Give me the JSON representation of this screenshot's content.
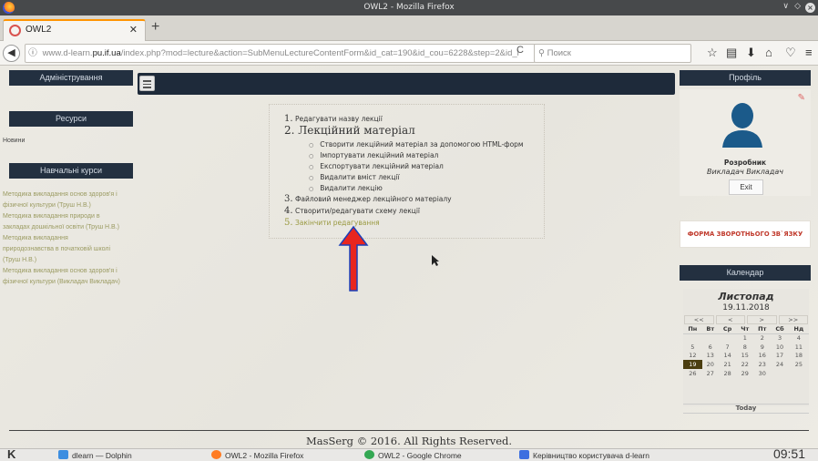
{
  "window": {
    "title": "OWL2 - Mozilla Firefox"
  },
  "tabs": [
    {
      "label": "OWL2"
    }
  ],
  "nav": {
    "url_prefix": "www.d-learn.",
    "url_domain": "pu.if.ua",
    "url_rest": "/index.php?mod=lecture&action=SubMenuLectureContentForm&id_cat=190&id_cou=6228&step=2&id_l",
    "search_placeholder": "Поиск"
  },
  "left_sidebar": {
    "admin_title": "Адміністрування",
    "resources_title": "Ресурси",
    "resources_items": [
      "Новини"
    ],
    "courses_title": "Навчальні курси",
    "courses_lines": [
      "Методика викладання основ здоров'я і",
      "фізичної культури (Труш Н.В.)",
      "Методика викладання природи в",
      "закладах дошкільної освіти (Труш Н.В.)",
      "Методика викладання",
      "природознавства в початковій школі",
      "(Труш Н.В.)",
      "Методика викладання основ здоров'я і",
      "фізичної культури (Викладач Викладач)"
    ]
  },
  "lecture_menu": {
    "items": [
      {
        "num": "1.",
        "label": "Редагувати назву лекції"
      },
      {
        "num": "2.",
        "label": "Лекційний матеріал"
      },
      {
        "num": "3.",
        "label": "Файловий менеджер лекційного матеріалу"
      },
      {
        "num": "4.",
        "label": "Створити/редагувати схему лекції"
      },
      {
        "num": "5.",
        "label": "Закінчити редагування"
      }
    ],
    "subitems": [
      "Створити лекційний матеріал за допомогою HTML-форм",
      "Імпортувати лекційний матеріал",
      "Експортувати лекційний матеріал",
      "Видалити вміст лекції",
      "Видалити лекцію"
    ]
  },
  "profile": {
    "title": "Профіль",
    "name": "Розробник",
    "role": "Викладач  Викладач",
    "exit_label": "Exit"
  },
  "feedback_label": "ФОРМА ЗВОРОТНЬОГО ЗВ`ЯЗКУ",
  "calendar": {
    "title": "Календар",
    "month": "Листопад",
    "date": "19.11.2018",
    "nav": [
      "<<",
      "<",
      ">",
      ">>"
    ],
    "weekdays": [
      "Пн",
      "Вт",
      "Ср",
      "Чт",
      "Пт",
      "Сб",
      "Нд"
    ],
    "weeks": [
      [
        "",
        "",
        "",
        "1",
        "2",
        "3",
        "4"
      ],
      [
        "5",
        "6",
        "7",
        "8",
        "9",
        "10",
        "11"
      ],
      [
        "12",
        "13",
        "14",
        "15",
        "16",
        "17",
        "18"
      ],
      [
        "19",
        "20",
        "21",
        "22",
        "23",
        "24",
        "25"
      ],
      [
        "26",
        "27",
        "28",
        "29",
        "30",
        "",
        ""
      ]
    ],
    "today_value": "19",
    "today_label": "Today"
  },
  "footer": "MasSerg © 2016. All Rights Reserved.",
  "taskbar": {
    "items": [
      {
        "label": "dlearn — Dolphin",
        "color": "#3d8ee0"
      },
      {
        "label": "OWL2 - Mozilla Firefox",
        "color": "#ff7b22"
      },
      {
        "label": "OWL2 - Google Chrome",
        "color": "#34a853"
      },
      {
        "label": "Керівництво користувача d-learn",
        "color": "#3d6fe0"
      }
    ],
    "clock": "09:51"
  },
  "colors": {
    "accent_arrow": "#e8261f",
    "panel_dark": "#233040"
  }
}
